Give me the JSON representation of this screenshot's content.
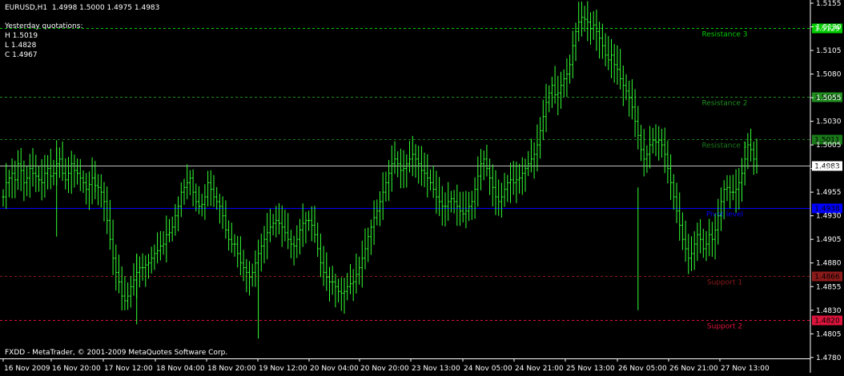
{
  "header": {
    "symbol_line": "EURUSD,H1  1.4998 1.5000 1.4975 1.4983",
    "yesterday_title": "Yesterday quotations:",
    "high": "H 1.5019",
    "low": "L 1.4828",
    "close": "C 1.4967"
  },
  "footer": {
    "copyright": "FXDD - MetaTrader, © 2001-2009 MetaQuotes Software Corp."
  },
  "colors": {
    "background": "#000000",
    "candles": "#33ff33",
    "axis_text": "#ffffff",
    "resistance3": "#00cc00",
    "resistance2": "#1f8f1f",
    "resistance1": "#1a7a1a",
    "pivot": "#0000ff",
    "support1": "#8b1a1a",
    "support2": "#dc143c",
    "current": "#c0c0c0"
  },
  "chart_data": {
    "type": "line",
    "symbol": "EURUSD",
    "timeframe": "H1",
    "ylim": [
      1.4779,
      1.5155
    ],
    "y_ticks": [
      "1.5155",
      "1.5130",
      "1.5105",
      "1.5080",
      "1.5055",
      "1.5030",
      "1.5005",
      "1.4980",
      "1.4955",
      "1.4930",
      "1.4905",
      "1.4880",
      "1.4855",
      "1.4830",
      "1.4805",
      "1.4780"
    ],
    "x_ticks": [
      "16 Nov 2009",
      "16 Nov 20:00",
      "17 Nov 12:00",
      "18 Nov 04:00",
      "18 Nov 20:00",
      "19 Nov 12:00",
      "20 Nov 04:00",
      "20 Nov 20:00",
      "23 Nov 13:00",
      "24 Nov 05:00",
      "24 Nov 21:00",
      "25 Nov 13:00",
      "26 Nov 05:00",
      "26 Nov 21:00",
      "27 Nov 13:00"
    ],
    "current_price": "1.4983",
    "levels": [
      {
        "name": "Resistance 3",
        "value": 1.5129,
        "tag": "1.5129",
        "color_key": "resistance3"
      },
      {
        "name": "Resistance 2",
        "value": 1.5056,
        "tag": "1.5056",
        "color_key": "resistance2"
      },
      {
        "name": "Resistance 1",
        "value": 1.5011,
        "tag": "1.5011",
        "color_key": "resistance1"
      },
      {
        "name": "Pivot level",
        "value": 1.4938,
        "tag": "1.4938",
        "color_key": "pivot"
      },
      {
        "name": "Support 1",
        "value": 1.4866,
        "tag": "1.4866",
        "color_key": "support1"
      },
      {
        "name": "Support 2",
        "value": 1.482,
        "tag": "1.4820",
        "color_key": "support2"
      }
    ],
    "close_path": [
      1.495,
      1.4965,
      1.497,
      1.4975,
      1.4968,
      1.4985,
      1.4978,
      1.4965,
      1.497,
      1.498,
      1.4975,
      1.4972,
      1.4968,
      1.4965,
      1.4975,
      1.498,
      1.4972,
      1.4975,
      1.4985,
      1.499,
      1.4975,
      1.4968,
      1.4975,
      1.4985,
      1.4978,
      1.4975,
      1.497,
      1.4965,
      1.4958,
      1.4963,
      1.497,
      1.4962,
      1.496,
      1.4955,
      1.4945,
      1.4925,
      1.4905,
      1.4885,
      1.487,
      1.486,
      1.4845,
      1.484,
      1.4845,
      1.4855,
      1.4862,
      1.487,
      1.4875,
      1.4875,
      1.4878,
      1.488,
      1.4885,
      1.489,
      1.4893,
      1.4898,
      1.49,
      1.491,
      1.4912,
      1.4918,
      1.493,
      1.494,
      1.4955,
      1.496,
      1.4965,
      1.497,
      1.4955,
      1.4945,
      1.494,
      1.4942,
      1.495,
      1.4965,
      1.4958,
      1.495,
      1.4945,
      1.494,
      1.493,
      1.4915,
      1.4905,
      1.49,
      1.49,
      1.489,
      1.488,
      1.4875,
      1.487,
      1.4865,
      1.487,
      1.488,
      1.489,
      1.4898,
      1.4905,
      1.4912,
      1.4918,
      1.4922,
      1.4925,
      1.4922,
      1.4918,
      1.4912,
      1.4905,
      1.49,
      1.4898,
      1.4905,
      1.4915,
      1.4922,
      1.4925,
      1.4925,
      1.492,
      1.491,
      1.4895,
      1.488,
      1.487,
      1.4865,
      1.486,
      1.486,
      1.4855,
      1.485,
      1.4848,
      1.485,
      1.4855,
      1.4858,
      1.486,
      1.4868,
      1.4875,
      1.4885,
      1.4895,
      1.4908,
      1.4918,
      1.4928,
      1.4935,
      1.4945,
      1.4955,
      1.4965,
      1.4975,
      1.4985,
      1.499,
      1.4985,
      1.4978,
      1.498,
      1.4985,
      1.499,
      1.4995,
      1.499,
      1.4985,
      1.4978,
      1.4975,
      1.497,
      1.4965,
      1.4958,
      1.495,
      1.4945,
      1.494,
      1.494,
      1.4945,
      1.4948,
      1.4945,
      1.494,
      1.4935,
      1.4932,
      1.4935,
      1.494,
      1.4945,
      1.4958,
      1.4972,
      1.4985,
      1.499,
      1.498,
      1.497,
      1.496,
      1.495,
      1.4945,
      1.495,
      1.4958,
      1.4965,
      1.4968,
      1.4965,
      1.4968,
      1.497,
      1.4975,
      1.498,
      1.4985,
      1.499,
      1.4995,
      1.5005,
      1.502,
      1.5035,
      1.505,
      1.506,
      1.5068,
      1.5058,
      1.506,
      1.5068,
      1.5075,
      1.508,
      1.509,
      1.511,
      1.5125,
      1.5135,
      1.514,
      1.5138,
      1.5135,
      1.5128,
      1.5132,
      1.5125,
      1.5118,
      1.511,
      1.51,
      1.5095,
      1.51,
      1.509,
      1.5085,
      1.5075,
      1.5068,
      1.5062,
      1.5055,
      1.5045,
      1.503,
      1.5015,
      1.5,
      1.499,
      1.4995,
      1.5005,
      1.501,
      1.5008,
      1.501,
      1.5005,
      1.4995,
      1.498,
      1.4965,
      1.495,
      1.4935,
      1.492,
      1.4905,
      1.4895,
      1.4885,
      1.489,
      1.49,
      1.491,
      1.4905,
      1.4895,
      1.49,
      1.491,
      1.4905,
      1.4915,
      1.493,
      1.4945,
      1.4958,
      1.496,
      1.4955,
      1.4955,
      1.4958,
      1.4965,
      1.4975,
      1.499,
      1.5005,
      1.5,
      1.499,
      1.4983
    ]
  }
}
